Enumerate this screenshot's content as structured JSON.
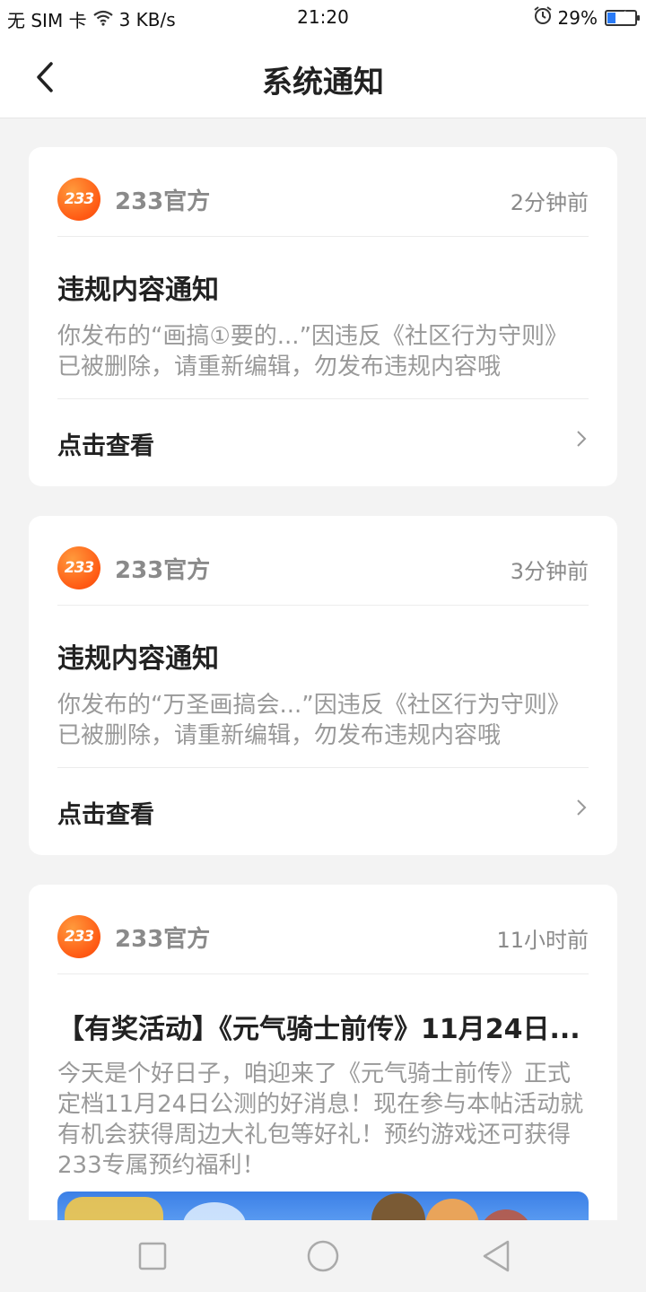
{
  "status_bar": {
    "carrier": "无 SIM 卡",
    "speed": "3 KB/s",
    "time": "21:20",
    "battery": "29%",
    "battery_level": 0.29
  },
  "header": {
    "title": "系统通知"
  },
  "notifications": [
    {
      "sender": "233官方",
      "avatar_text": "233",
      "time": "2分钟前",
      "title": "违规内容通知",
      "body": "你发布的“画搞①要的...”因违反《社区行为守则》已被删除，请重新编辑，勿发布违规内容哦",
      "action": "点击查看"
    },
    {
      "sender": "233官方",
      "avatar_text": "233",
      "time": "3分钟前",
      "title": "违规内容通知",
      "body": "你发布的“万圣画搞会...”因违反《社区行为守则》已被删除，请重新编辑，勿发布违规内容哦",
      "action": "点击查看"
    },
    {
      "sender": "233官方",
      "avatar_text": "233",
      "time": "11小时前",
      "title": "【有奖活动】《元气骑士前传》11月24日...",
      "body": "今天是个好日子，咱迎来了《元气骑士前传》正式定档11月24日公测的好消息！现在参与本帖活动就有机会获得周边大礼包等好礼！预约游戏还可获得233专属预约福利！"
    }
  ],
  "colors": {
    "avatar": "#ff5a14",
    "page_bg": "#f3f3f3",
    "battery_fill": "#2a7bf6"
  }
}
